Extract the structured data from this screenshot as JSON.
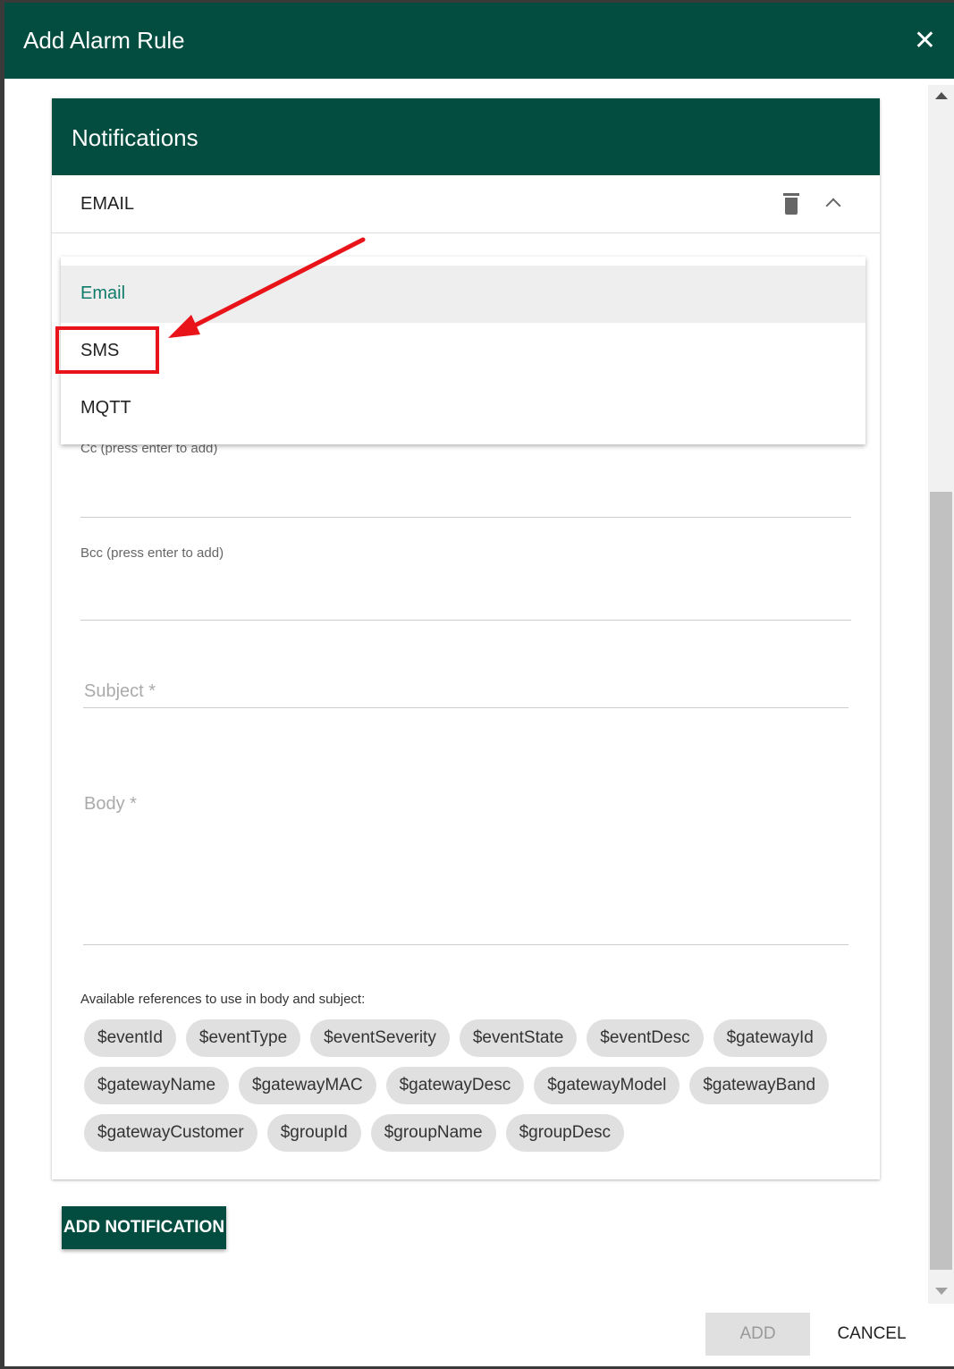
{
  "dialog": {
    "title": "Add Alarm Rule",
    "close_icon": "close-icon"
  },
  "section": {
    "title": "Notifications"
  },
  "panel": {
    "type_label": "EMAIL",
    "delete_icon": "trash-icon",
    "collapse_icon": "chevron-up-icon"
  },
  "dropdown": {
    "options": [
      "Email",
      "SMS",
      "MQTT"
    ],
    "selected": "Email",
    "highlighted": "SMS"
  },
  "fields": {
    "cc_label": "Cc (press enter to add)",
    "bcc_label": "Bcc (press enter to add)",
    "subject_placeholder": "Subject *",
    "body_placeholder": "Body *"
  },
  "references": {
    "label": "Available references to use in body and subject:",
    "chips": [
      "$eventId",
      "$eventType",
      "$eventSeverity",
      "$eventState",
      "$eventDesc",
      "$gatewayId",
      "$gatewayName",
      "$gatewayMAC",
      "$gatewayDesc",
      "$gatewayModel",
      "$gatewayBand",
      "$gatewayCustomer",
      "$groupId",
      "$groupName",
      "$groupDesc"
    ]
  },
  "buttons": {
    "add_notification": "ADD NOTIFICATION",
    "add": "ADD",
    "cancel": "CANCEL"
  },
  "colors": {
    "primary": "#024d3f",
    "annotation": "#e8141a",
    "selected_text": "#0f7b6a"
  }
}
